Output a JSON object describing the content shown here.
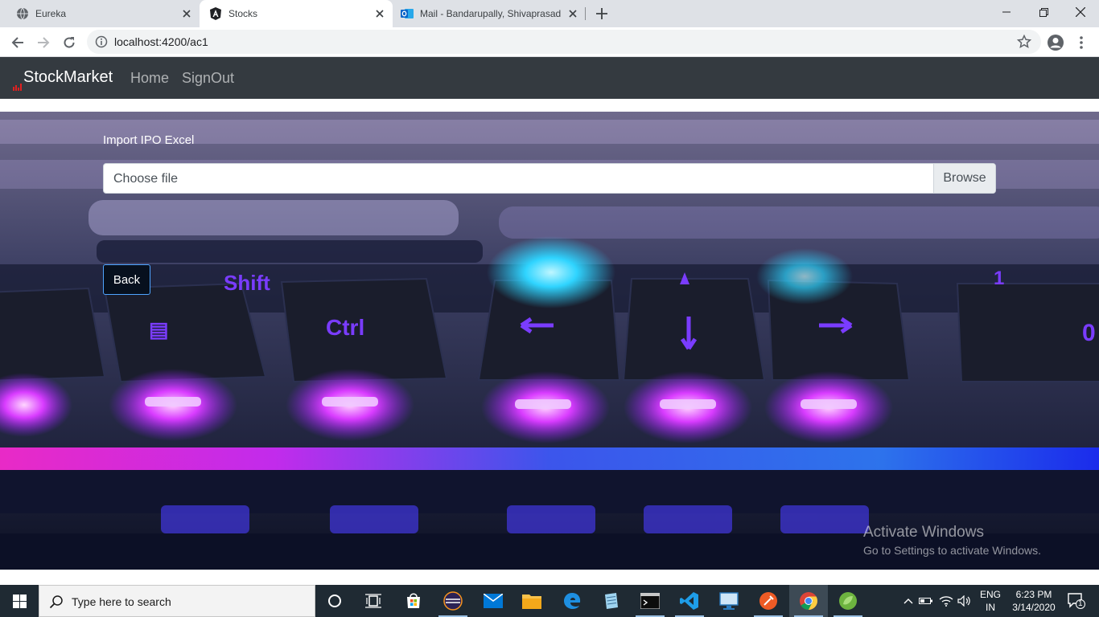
{
  "browser": {
    "tabs": [
      {
        "title": "Eureka",
        "active": false
      },
      {
        "title": "Stocks",
        "active": true
      },
      {
        "title": "Mail - Bandarupally, Shivaprasad",
        "active": false
      }
    ],
    "url": "localhost:4200/ac1"
  },
  "navbar": {
    "brand": "StockMarket",
    "links": [
      "Home",
      "SignOut"
    ]
  },
  "form": {
    "label": "Import IPO Excel",
    "file_placeholder": "Choose file",
    "browse_label": "Browse",
    "back_label": "Back"
  },
  "watermark": {
    "title": "Activate Windows",
    "subtitle": "Go to Settings to activate Windows."
  },
  "taskbar": {
    "search_placeholder": "Type here to search",
    "lang_line1": "ENG",
    "lang_line2": "IN",
    "time": "6:23 PM",
    "date": "3/14/2020",
    "notification_count": "1",
    "apps": [
      "task-view",
      "microsoft-store",
      "eclipse",
      "mail",
      "file-explorer",
      "edge",
      "notepad",
      "cmd",
      "vscode",
      "remote-desktop",
      "postman",
      "chrome",
      "spring-tool-suite"
    ]
  },
  "colors": {
    "navbar_bg": "#343a40",
    "accent": "#4ea4ff",
    "taskbar_bg": "#1f2a33"
  }
}
